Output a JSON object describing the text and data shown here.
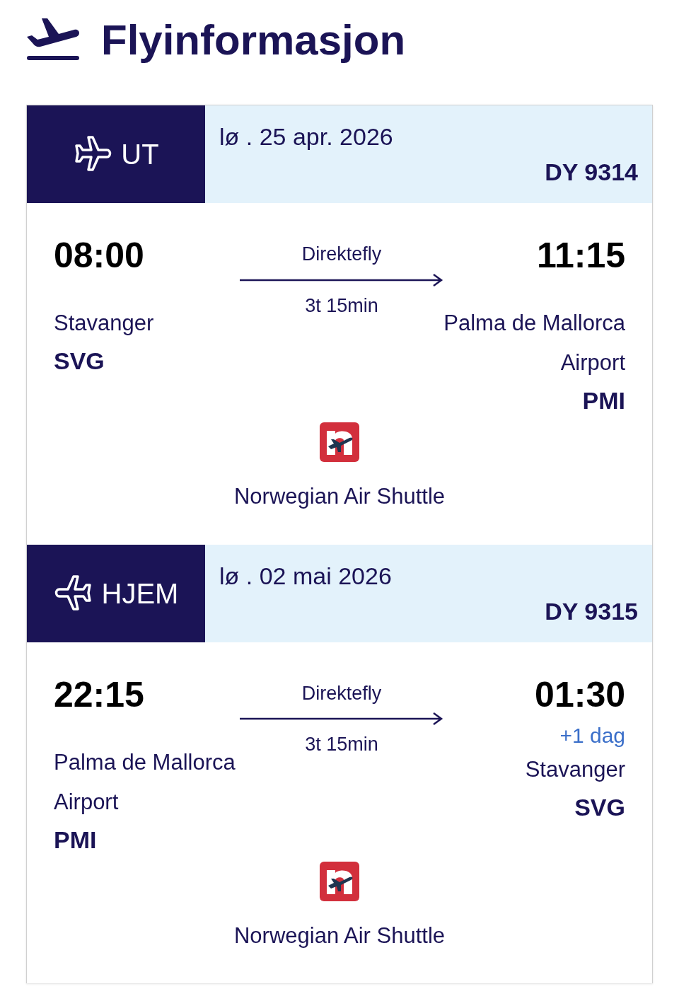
{
  "title": "Flyinformasjon",
  "flights": [
    {
      "kind": "outbound",
      "label": "UT",
      "date": "lø . 25 apr. 2026",
      "flight_number": "DY 9314",
      "departure": {
        "time": "08:00",
        "city": "Stavanger",
        "code": "SVG"
      },
      "route_type": "Direktefly",
      "duration": "3t 15min",
      "arrival": {
        "time": "11:15",
        "city": "Palma de Mallorca Airport",
        "code": "PMI"
      },
      "airline": "Norwegian Air Shuttle"
    },
    {
      "kind": "return",
      "label": "HJEM",
      "date": "lø . 02 mai 2026",
      "flight_number": "DY 9315",
      "departure": {
        "time": "22:15",
        "city": "Palma de Mallorca Airport",
        "code": "PMI"
      },
      "route_type": "Direktefly",
      "duration": "3t 15min",
      "arrival": {
        "time": "01:30",
        "day_offset": "+1 dag",
        "city": "Stavanger",
        "code": "SVG"
      },
      "airline": "Norwegian Air Shuttle"
    }
  ]
}
